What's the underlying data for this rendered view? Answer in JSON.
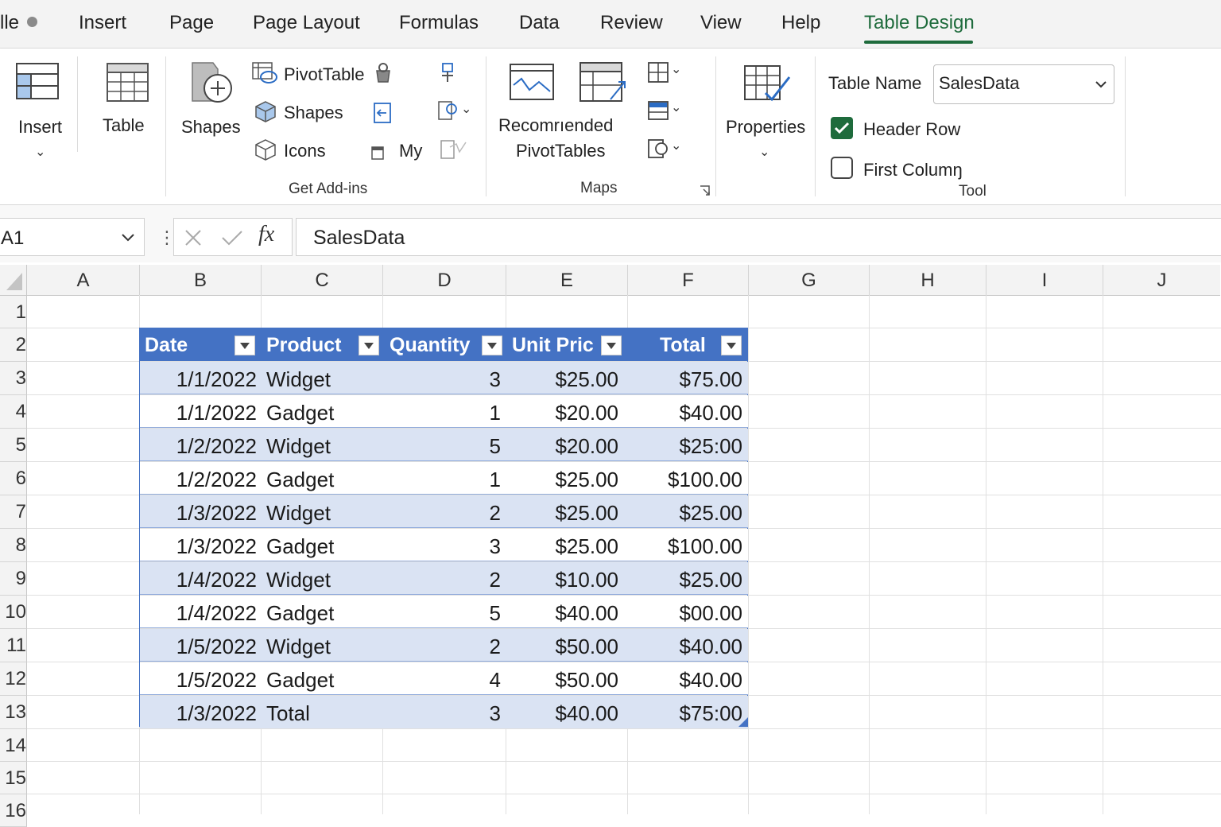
{
  "tabs": [
    {
      "label": "lle",
      "active": false
    },
    {
      "label": "Insert",
      "active": false
    },
    {
      "label": "Page",
      "active": false
    },
    {
      "label": "Page Layout",
      "active": false
    },
    {
      "label": "Formulas",
      "active": false
    },
    {
      "label": "Data",
      "active": false
    },
    {
      "label": "Review",
      "active": false
    },
    {
      "label": "View",
      "active": false
    },
    {
      "label": "Help",
      "active": false
    },
    {
      "label": "Table Design",
      "active": true
    }
  ],
  "ribbon": {
    "insert_label": "Insert",
    "table_label": "Table",
    "shapes_label": "Shapes",
    "pivottable_label": "PivotTable",
    "shapes_small_label": "Shapes",
    "icons_label": "Icons",
    "my_label": "My",
    "addins_group": "Get Add-ins",
    "recommended_line1": "Recomrıended",
    "recommended_line2": "PivotTables",
    "maps_group": "Maps",
    "properties_label": "Properties",
    "table_name_label": "Table Name",
    "table_name_value": "SalesData",
    "header_row_label": "Header Row",
    "header_row_checked": true,
    "first_column_label": "First Columŋ",
    "first_column_checked": false,
    "tool_group": "Tool"
  },
  "formula_bar": {
    "name_box": "A1",
    "fx": "fx",
    "content": "SalesData"
  },
  "columns": [
    "A",
    "B",
    "C",
    "D",
    "E",
    "F",
    "G",
    "H",
    "I",
    "J"
  ],
  "rows": [
    "1",
    "2",
    "3",
    "4",
    "5",
    "6",
    "7",
    "8",
    "9",
    "10",
    "11",
    "12",
    "13",
    "14",
    "15",
    "16"
  ],
  "table": {
    "headers": [
      "Date",
      "Product",
      "Quantity",
      "Unit Pric",
      "Total"
    ],
    "rows": [
      [
        "1/1/2022",
        "Widget",
        "3",
        "$25.00",
        "$75.00"
      ],
      [
        "1/1/2022",
        "Gadget",
        "1",
        "$20.00",
        "$40.00"
      ],
      [
        "1/2/2022",
        "Widget",
        "5",
        "$20.00",
        "$25:00"
      ],
      [
        "1/2/2022",
        "Gadget",
        "1",
        "$25.00",
        "$100.00"
      ],
      [
        "1/3/2022",
        "Widget",
        "2",
        "$25.00",
        "$25.00"
      ],
      [
        "1/3/2022",
        "Gadget",
        "3",
        "$25.00",
        "$100.00"
      ],
      [
        "1/4/2022",
        "Widget",
        "2",
        "$10.00",
        "$25.00"
      ],
      [
        "1/4/2022",
        "Gadget",
        "5",
        "$40.00",
        "$00.00"
      ],
      [
        "1/5/2022",
        "Widget",
        "2",
        "$50.00",
        "$40.00"
      ],
      [
        "1/5/2022",
        "Gadget",
        "4",
        "$50.00",
        "$40.00"
      ],
      [
        "1/3/2022",
        "Total",
        "3",
        "$40.00",
        "$75:00"
      ]
    ]
  },
  "colors": {
    "accent_green": "#1e6b3c",
    "table_header": "#4472c4",
    "band_row": "#dae3f3",
    "table_border": "#8faadc"
  }
}
